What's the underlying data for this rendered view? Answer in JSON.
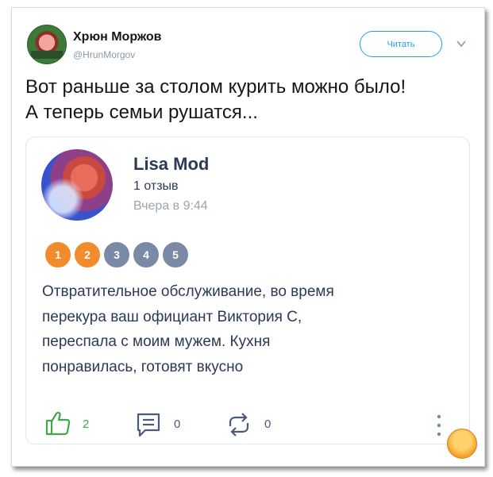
{
  "tweet": {
    "author_name": "Хрюн Моржов",
    "author_handle": "@HrunMorgov",
    "follow_label": "Читать",
    "text_line1": "Вот раньше за столом курить можно было!",
    "text_line2": "А теперь семьи рушатся..."
  },
  "review": {
    "reviewer_name": "Lisa Mod",
    "review_count": "1 отзыв",
    "time": "Вчера в 9:44",
    "rating_value": 2,
    "rating_options": [
      "1",
      "2",
      "3",
      "4",
      "5"
    ],
    "text_lines": [
      "Отвратительное обслуживание, во время",
      "перекура ваш официант Виктория С,",
      "переспала с моим мужем. Кухня",
      "понравилась, готовят вкусно"
    ],
    "likes": "2",
    "comments": "0",
    "reposts": "0"
  },
  "colors": {
    "accent": "#1da1f2",
    "rating_active": "#f28b2b",
    "rating_inactive": "#7a8aa6",
    "like_green": "#3fa84b",
    "icon_gray": "#4a5a7a"
  },
  "icons": {
    "follow_menu": "chevron-down-icon",
    "like": "thumbs-up-icon",
    "comment": "comment-icon",
    "repost": "repost-icon",
    "more": "more-vertical-icon"
  }
}
